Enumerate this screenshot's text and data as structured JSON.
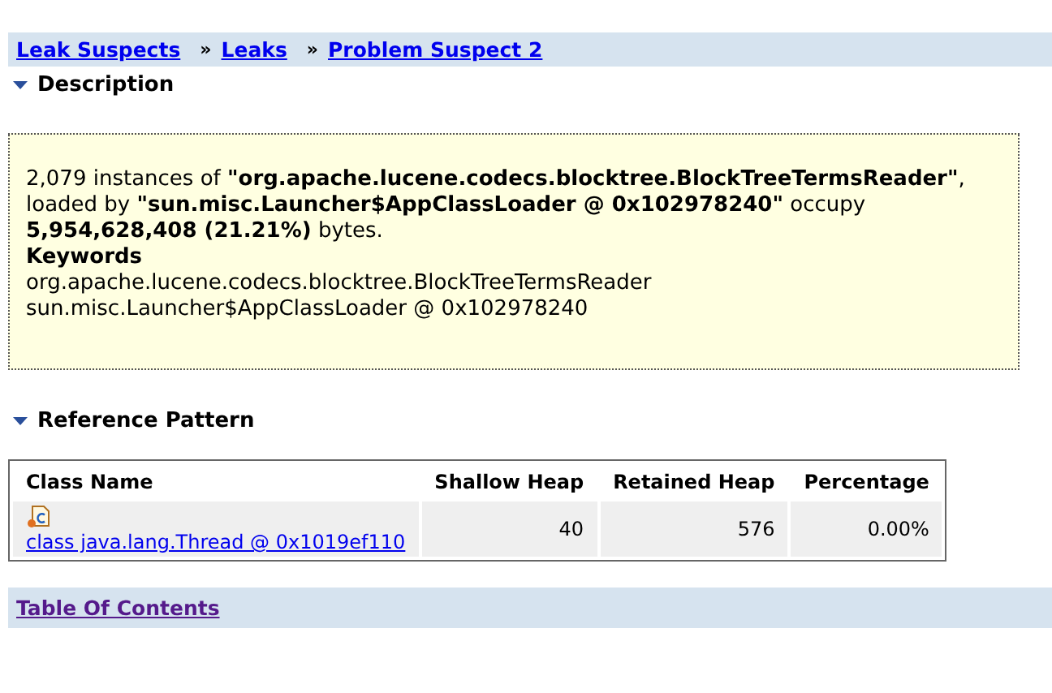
{
  "breadcrumb": [
    {
      "label": "Leak Suspects",
      "visited": false
    },
    {
      "label": "Leaks",
      "visited": false
    },
    {
      "label": "Problem Suspect 2",
      "visited": false
    }
  ],
  "breadcrumb_separator": "»",
  "description": {
    "title": "Description",
    "expanded": true,
    "text": "2,079 instances of **\"org.apache.lucene.codecs.blocktree.BlockTreeTermsReader\"**, loaded by **\"sun.misc.Launcher$AppClassLoader @ 0x102978240\"** occupy **5,954,628,408 (21.21%)** bytes.",
    "keywords_title": "Keywords",
    "keywords": [
      "org.apache.lucene.codecs.blocktree.BlockTreeTermsReader",
      "sun.misc.Launcher$AppClassLoader @ 0x102978240"
    ]
  },
  "reference_pattern": {
    "title": "Reference Pattern",
    "expanded": true,
    "columns": [
      "Class Name",
      "Shallow Heap",
      "Retained Heap",
      "Percentage"
    ],
    "rows": [
      {
        "class_name": "class java.lang.Thread @ 0x1019ef110",
        "shallow_heap": "40",
        "retained_heap": "576",
        "percentage": "0.00%"
      }
    ]
  },
  "footer_link": {
    "label": "Table Of Contents",
    "visited": true
  }
}
